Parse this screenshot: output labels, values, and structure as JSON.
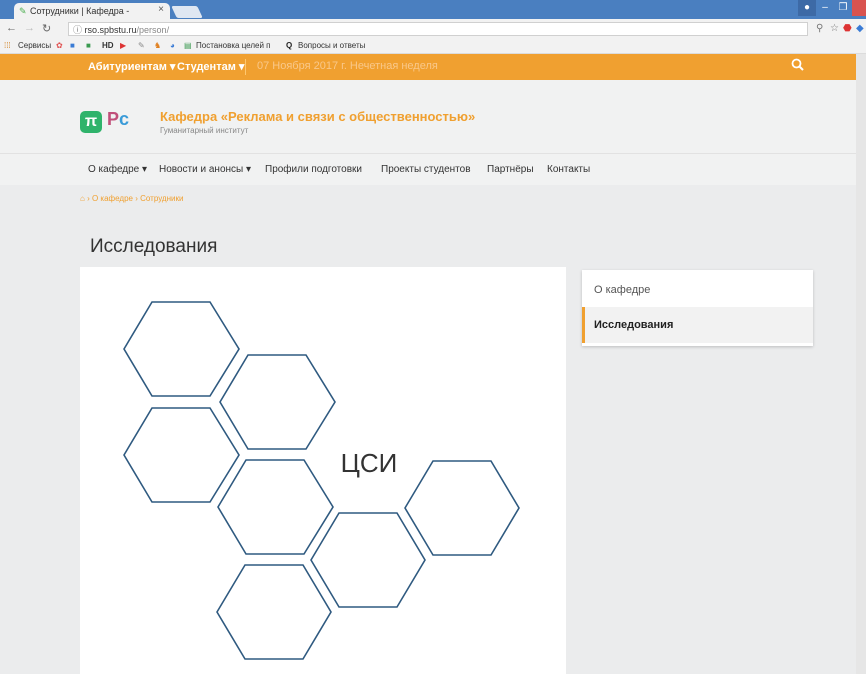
{
  "browser": {
    "tab_title": "Сотрудники | Кафедра -",
    "tab_close": "×",
    "url_host": "rso.spbstu.ru",
    "url_path": "/person/",
    "bookmarks": [
      "Сервисы",
      "HD",
      "Постановка целей п",
      "Вопросы и ответы"
    ]
  },
  "topbar": {
    "menu_applicants": "Абитуриентам ▾",
    "menu_students": "Студентам ▾",
    "date": "07 Ноября 2017 г. Нечетная неделя",
    "search_icon": "search-icon"
  },
  "header": {
    "logo_pi": "π",
    "logo_ps_left": "Р",
    "logo_ps_right": "с",
    "title": "Кафедра «Реклама и связи с общественностью»",
    "subtitle": "Гуманитарный институт"
  },
  "nav": {
    "items": [
      "О кафедре ▾",
      "Новости и анонсы ▾",
      "Профили подготовки",
      "Проекты студентов",
      "Партнёры",
      "Контакты"
    ]
  },
  "breadcrumb": {
    "home_icon": "home-icon",
    "sep": "›",
    "item1": "О кафедре",
    "item2": "Сотрудники"
  },
  "page": {
    "title": "Исследования",
    "image_text": "ЦСИ"
  },
  "sidebar": {
    "items": [
      "О кафедре",
      "Исследования"
    ]
  },
  "colors": {
    "accent": "#f0a030",
    "hex_stroke": "#2f5a80"
  }
}
